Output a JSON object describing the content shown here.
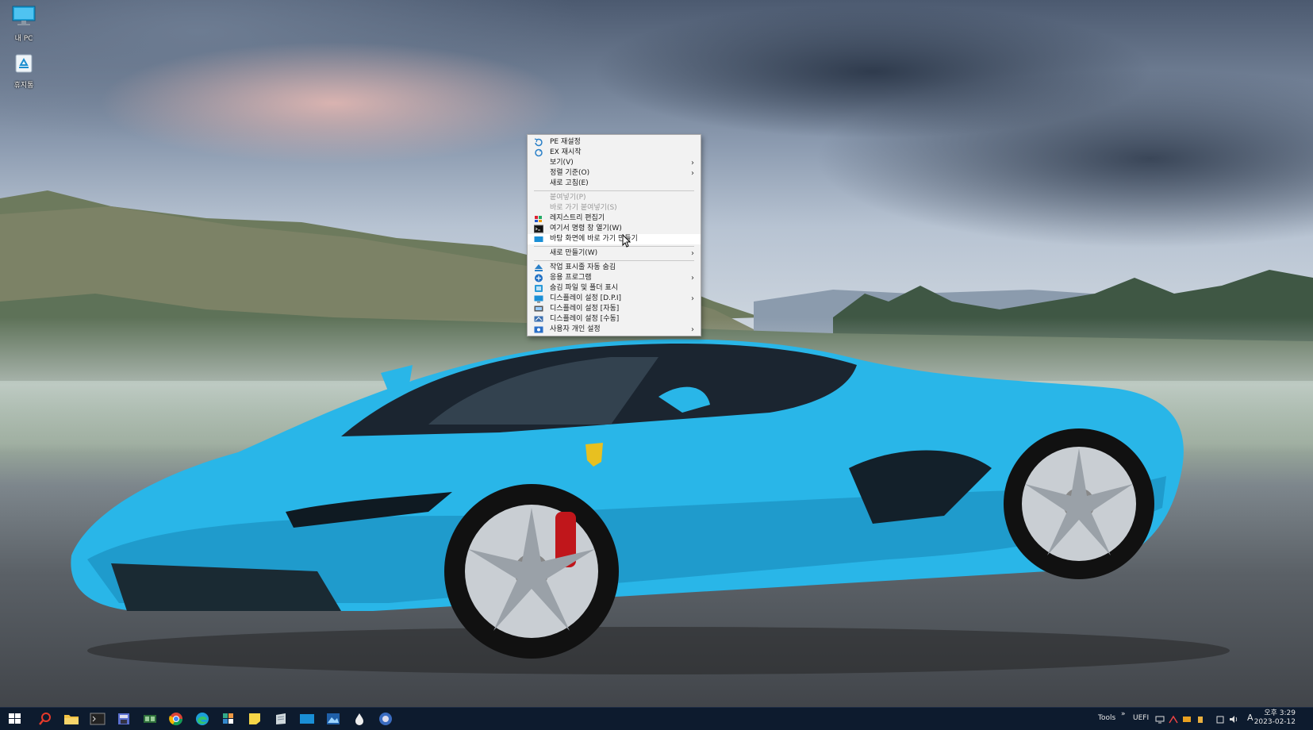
{
  "desktop": {
    "icons": [
      {
        "label": "내 PC",
        "icon": "monitor-icon"
      },
      {
        "label": "휴지통",
        "icon": "recycle-bin-icon"
      }
    ]
  },
  "context_menu": {
    "items": [
      {
        "label": "PE 재설정",
        "icon": "refresh-icon",
        "enabled": true,
        "submenu": false
      },
      {
        "label": "EX 재시작",
        "icon": "restart-icon",
        "enabled": true,
        "submenu": false
      },
      {
        "label": "보기(V)",
        "enabled": true,
        "submenu": true
      },
      {
        "label": "정렬 기준(O)",
        "enabled": true,
        "submenu": true
      },
      {
        "label": "새로 고침(E)",
        "enabled": true,
        "submenu": false
      },
      {
        "label": "붙여넣기(P)",
        "enabled": false,
        "submenu": false
      },
      {
        "label": "바로 가기 붙여넣기(S)",
        "enabled": false,
        "submenu": false
      },
      {
        "label": "레지스트리 편집기",
        "icon": "registry-icon",
        "enabled": true,
        "submenu": false
      },
      {
        "label": "여기서 명령 창 열기(W)",
        "icon": "cmd-icon",
        "enabled": true,
        "submenu": false
      },
      {
        "label": "바탕 화면에 바로 가기 만들기",
        "icon": "shortcut-icon",
        "enabled": true,
        "submenu": false,
        "highlighted": true
      },
      {
        "label": "새로 만들기(W)",
        "enabled": true,
        "submenu": true
      },
      {
        "label": "작업 표시줄 자동 숨김",
        "icon": "taskbar-hide-icon",
        "enabled": true,
        "submenu": false
      },
      {
        "label": "응용 프로그램",
        "icon": "apps-icon",
        "enabled": true,
        "submenu": true
      },
      {
        "label": "숨김 파일 및 폴더 표시",
        "icon": "hidden-files-icon",
        "enabled": true,
        "submenu": false
      },
      {
        "label": "디스플레이 설정 [D.P.I]",
        "icon": "display-dpi-icon",
        "enabled": true,
        "submenu": true
      },
      {
        "label": "디스플레이 설정 [자동]",
        "icon": "display-auto-icon",
        "enabled": true,
        "submenu": false
      },
      {
        "label": "디스플레이 설정 [수동]",
        "icon": "display-manual-icon",
        "enabled": true,
        "submenu": false
      },
      {
        "label": "사용자 개인 설정",
        "icon": "personalize-icon",
        "enabled": true,
        "submenu": true
      }
    ]
  },
  "taskbar": {
    "tray": {
      "tools_label": "Tools",
      "uefi_label": "UEFI",
      "ime_label": "A",
      "overflow": "»"
    },
    "clock": {
      "time": "오후 3:29",
      "date": "2023-02-12"
    }
  },
  "colors": {
    "taskbar_bg": "#0d1b2e",
    "car_body": "#29b6e8",
    "menu_bg": "#f2f2f2"
  }
}
